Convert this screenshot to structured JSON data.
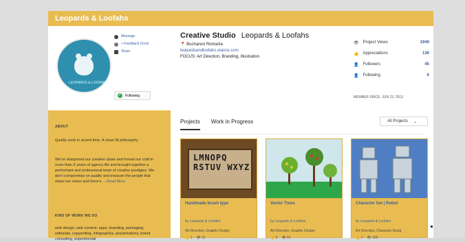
{
  "topbar": {
    "brand": "Leopards & Loofahs"
  },
  "profile": {
    "avatar_caption": "LEOPARDS & LOOFAHS",
    "links": [
      {
        "label": "Message"
      },
      {
        "label": "+ Feedback Circle"
      },
      {
        "label": "Share"
      }
    ],
    "follow_label": "Following",
    "studio_label": "Creative Studio",
    "name": "Leopards & Loofahs",
    "location": "Bucharest Romania",
    "email": "leopardsandloofahs.elance.com",
    "focus": "FOCUS: Art Direction, Branding, Illustration"
  },
  "stats": [
    {
      "icon": "eye-icon",
      "label": "Project Views",
      "value": "1949"
    },
    {
      "icon": "thumbs-up-icon",
      "label": "Appreciations",
      "value": "136"
    },
    {
      "icon": "followers-icon",
      "label": "Followers",
      "value": "45"
    },
    {
      "icon": "following-icon",
      "label": "Following",
      "value": "6"
    }
  ],
  "member_since": "MEMBER SINCE: JUN 23, 2013",
  "sidebar": {
    "about_title": "ABOUT",
    "about_text_1": "Quality work in record time. A clean lill philosophy.",
    "about_text_2": "We've sharpened our creative claws and honed our craft in more than X years of agency life and brought together a performant and professional team of creative prodigies. We don't compromise on quality and treasure the people that share our vision and there's ...",
    "read_more": "Read More",
    "kind_title": "KIND OF WORK WE DO",
    "kind_text": "web design, web content, apps, branding, packaging, editorials, copywriting, infographics, presentations, brand consulting, experimental"
  },
  "main": {
    "tabs": [
      {
        "label": "Projects"
      },
      {
        "label": "Work in Progress"
      }
    ],
    "dropdown_label": "All Projects"
  },
  "projects": [
    {
      "title": "Handmade brush type",
      "by": "by Leopards & Loofahs",
      "fields": "Art Direction, Graphic Design",
      "appreciations": "1",
      "views": "31",
      "thumb_text": "LMNOPQ RSTUV WXYZ"
    },
    {
      "title": "Vector Trees",
      "by": "by Leopards & Loofahs",
      "fields": "Art Direction, Graphic Design",
      "appreciations": "0",
      "views": "61",
      "thumb_text": ""
    },
    {
      "title": "Character Set | Robot",
      "by": "by Leopards & Loofahs",
      "fields": "Art Direction, Character Desig",
      "appreciations": "7",
      "views": "335",
      "thumb_text": ""
    }
  ],
  "colors": {
    "accent": "#e8bc50",
    "link": "#3a5f9e",
    "green": "#2ea64a"
  }
}
